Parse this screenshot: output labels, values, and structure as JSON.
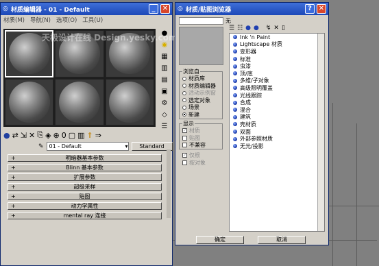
{
  "left_window": {
    "title": "材质编辑器 - 01 - Default",
    "menu": [
      "材质(M)",
      "导航(N)",
      "选项(O)",
      "工具(U)"
    ],
    "watermark": "天极设计在线  Design.yesky.com",
    "material_name": "01 - Default",
    "material_type": "Standard",
    "rollouts": [
      "明暗器基本参数",
      "Blinn 基本参数",
      "扩展参数",
      "超级采样",
      "贴图",
      "动力学属性",
      "mental ray 连接"
    ]
  },
  "right_window": {
    "title": "材质/贴图浏览器",
    "search_value": "",
    "preview_label": "无",
    "browse_from": {
      "label": "浏览自",
      "options": [
        {
          "label": "材质库",
          "selected": false,
          "enabled": true
        },
        {
          "label": "材质编辑器",
          "selected": false,
          "enabled": true
        },
        {
          "label": "活动示例窗",
          "selected": false,
          "enabled": false
        },
        {
          "label": "选定对象",
          "selected": false,
          "enabled": true
        },
        {
          "label": "场景",
          "selected": false,
          "enabled": true
        },
        {
          "label": "新建",
          "selected": true,
          "enabled": true
        }
      ]
    },
    "show": {
      "label": "显示",
      "options": [
        {
          "label": "材质",
          "checked": true,
          "enabled": false
        },
        {
          "label": "贴图",
          "checked": false,
          "enabled": false
        },
        {
          "label": "不兼容",
          "checked": false,
          "enabled": true
        }
      ]
    },
    "extra_options": [
      {
        "label": "仅根",
        "checked": true,
        "enabled": false
      },
      {
        "label": "按对象",
        "checked": false,
        "enabled": false
      }
    ],
    "list_items": [
      "Ink 'n Paint",
      "Lightscape 材质",
      "变形器",
      "标准",
      "虫漆",
      "顶/底",
      "多维/子对象",
      "高级照明覆盖",
      "光线跟踪",
      "合成",
      "混合",
      "建筑",
      "壳材质",
      "双面",
      "外部参照材质",
      "无光/投影"
    ],
    "ok_label": "确定",
    "cancel_label": "取消"
  }
}
